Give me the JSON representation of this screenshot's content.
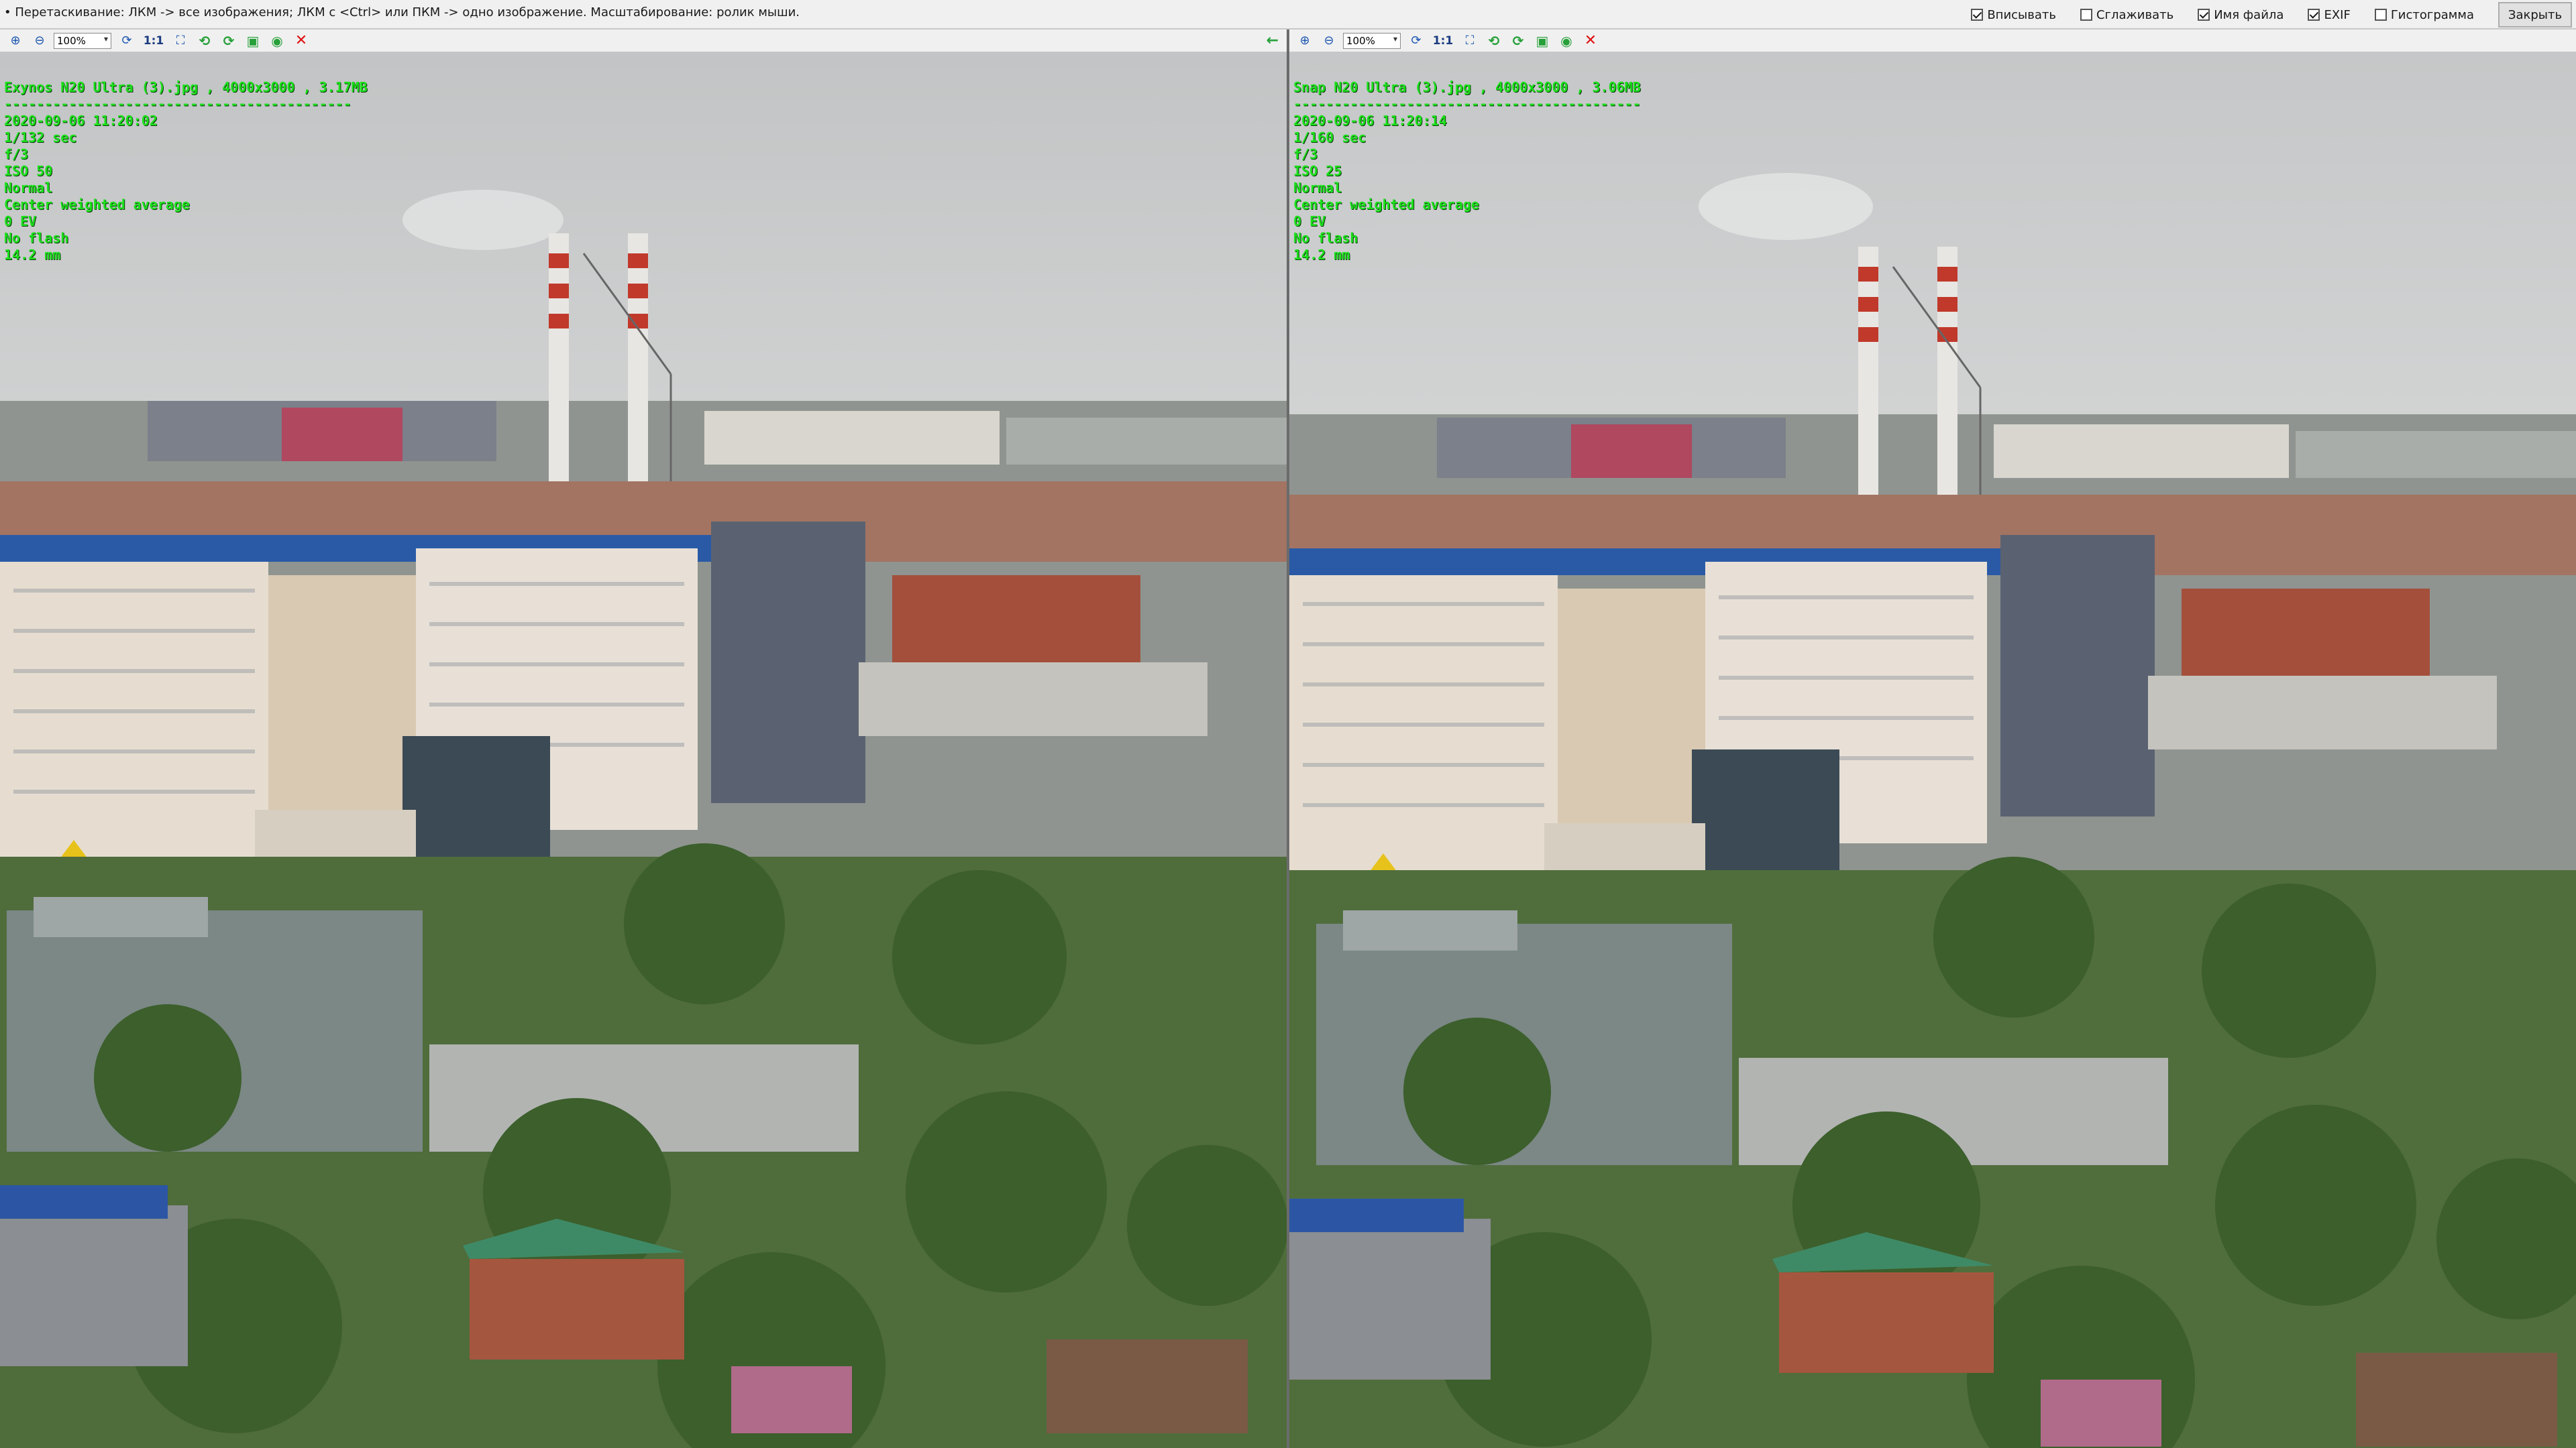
{
  "hint": "• Перетаскивание: ЛКМ -> все изображения; ЛКМ с <Ctrl> или ПКМ -> одно изображение. Масштабирование: ролик мыши.",
  "options": [
    {
      "label": "Вписывать",
      "checked": true
    },
    {
      "label": "Сглаживать",
      "checked": false
    },
    {
      "label": "Имя файла",
      "checked": true
    },
    {
      "label": "EXIF",
      "checked": true
    },
    {
      "label": "Гистограмма",
      "checked": false
    }
  ],
  "close_label": "Закрыть",
  "toolbar": {
    "zoom": "100%",
    "one_to_one": "1:1"
  },
  "left": {
    "file": "Exynos N20 Ultra (3).jpg  ,  4000x3000  ,  3.17MB",
    "separator": "-------------------------------------------",
    "exif": [
      "2020-09-06 11:20:02",
      "1/132 sec",
      "f/3",
      "ISO 50",
      "Normal",
      "Center weighted average",
      "0 EV",
      "No flash",
      "14.2 mm"
    ]
  },
  "right": {
    "file": "Snap N20 Ultra (3).jpg  ,  4000x3000  ,  3.06MB",
    "separator": "-------------------------------------------",
    "exif": [
      "2020-09-06 11:20:14",
      "1/160 sec",
      "f/3",
      "ISO 25",
      "Normal",
      "Center weighted average",
      "0 EV",
      "No flash",
      "14.2 mm"
    ]
  },
  "colors": {
    "overlay_text": "#1be01b",
    "sky": "#c9cbcc",
    "foliage": "#3f6b32",
    "brick": "#a5563f"
  }
}
